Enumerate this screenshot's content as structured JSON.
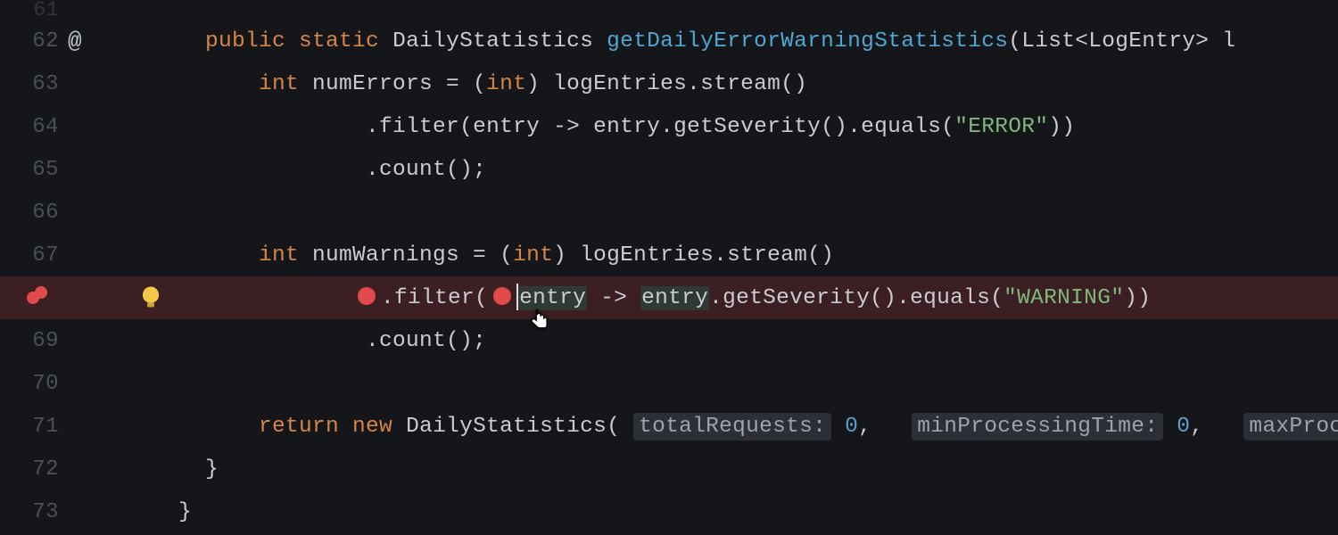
{
  "lines": {
    "l61": "61",
    "l62": "62",
    "l63": "63",
    "l64": "64",
    "l65": "65",
    "l66": "66",
    "l67": "67",
    "l68": "",
    "l69": "69",
    "l70": "70",
    "l71": "71",
    "l72": "72",
    "l73": "73"
  },
  "atSymbol": "@",
  "code": {
    "kw_public": "public",
    "kw_static": "static",
    "kw_int": "int",
    "kw_return": "return",
    "kw_new": "new",
    "type_DailyStatistics": "DailyStatistics",
    "method_name": "getDailyErrorWarningStatistics",
    "param_list_open": "(List<LogEntry> l",
    "numErrors_decl_a": " numErrors = (",
    "cast_int": "int",
    "numErrors_decl_b": ") logEntries.stream()",
    "filter_open": ".filter(",
    "entry_ident": "entry",
    "arrow": " -> ",
    "entry2": "entry",
    "getSeverity": ".getSeverity().equals(",
    "str_error": "\"ERROR\"",
    "str_warning": "\"WARNING\"",
    "close_pp": "))",
    "count": ".count();",
    "numWarnings_decl_a": " numWarnings = (",
    "construct_open": " DailyStatistics( ",
    "hint_totalRequests": "totalRequests:",
    "zero1": "0",
    "comma": ",",
    "hint_minProcessing": "minProcessingTime:",
    "zero2": "0",
    "hint_maxProcessing": "maxProcessin",
    "close_brace": "}",
    "close_brace2": "}"
  }
}
